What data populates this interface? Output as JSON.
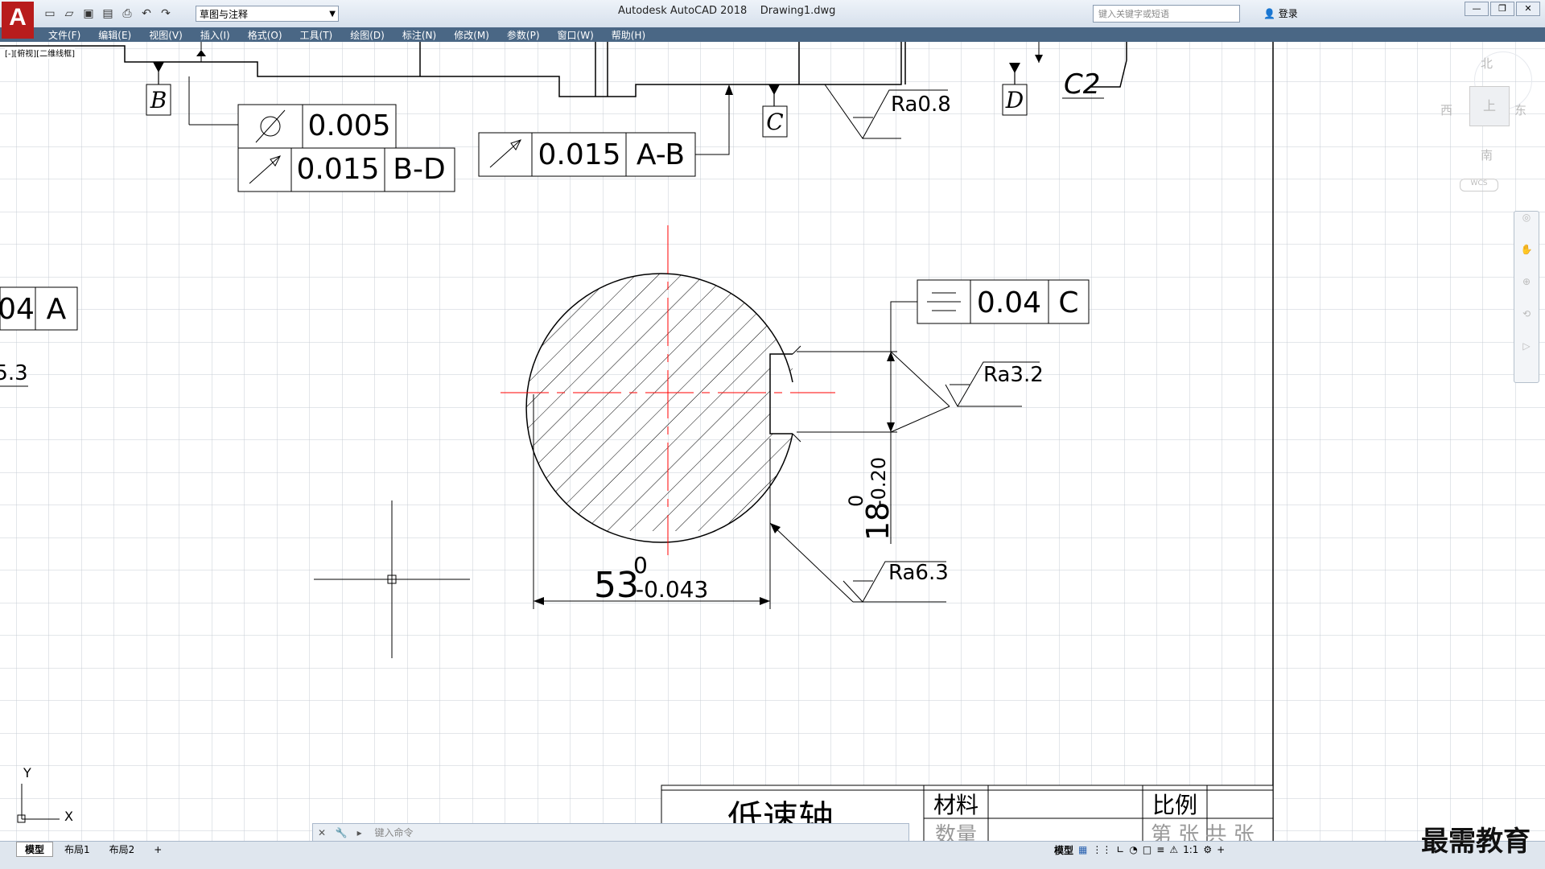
{
  "app": {
    "title": "Autodesk AutoCAD 2018",
    "file": "Drawing1.dwg",
    "logo": "A"
  },
  "workspace": {
    "value": "草图与注释"
  },
  "search": {
    "placeholder": "键入关键字或短语"
  },
  "user": {
    "login": "登录"
  },
  "menu": [
    "文件(F)",
    "编辑(E)",
    "视图(V)",
    "插入(I)",
    "格式(O)",
    "工具(T)",
    "绘图(D)",
    "标注(N)",
    "修改(M)",
    "参数(P)",
    "窗口(W)",
    "帮助(H)"
  ],
  "viewport_label": "[-][俯视][二维线框]",
  "viewcube": {
    "north": "北",
    "south": "南",
    "east": "东",
    "west": "西",
    "top": "上",
    "wcs": "WCS"
  },
  "drawing": {
    "datums": [
      "B",
      "C",
      "D"
    ],
    "chamfer": "C2",
    "roughness": [
      "Ra0.8",
      "Ra3.2",
      "Ra6.3"
    ],
    "fcf_cylindricity": "0.005",
    "fcf_runout_1": {
      "value": "0.015",
      "datum": "B-D"
    },
    "fcf_runout_2": {
      "value": "0.015",
      "datum": "A-B"
    },
    "fcf_symmetry": {
      "value": "0.04",
      "datum": "C"
    },
    "left_partial": {
      "value": "04",
      "datum": "A",
      "rough": "5.3"
    },
    "dim_diameter": {
      "base": "53",
      "upper": "0",
      "lower": "-0.043"
    },
    "dim_keyway": {
      "base": "18",
      "upper": "0",
      "lower": "-0.20"
    },
    "ucs": {
      "x": "X",
      "y": "Y"
    },
    "title_block": {
      "name": "低速轴",
      "material": "材料",
      "scale": "比例",
      "qty": "数量",
      "sheet": "第 张 共 张"
    }
  },
  "command": {
    "placeholder": "键入命令"
  },
  "tabs": [
    "模型",
    "布局1",
    "布局2"
  ],
  "status": {
    "model": "模型",
    "scale": "1:1"
  },
  "watermark": "最需教育",
  "colors": {
    "menubar": "#4a6785",
    "grid": "#c7ccd4",
    "centerline": "#ff0000",
    "logo": "#b81c1c"
  }
}
